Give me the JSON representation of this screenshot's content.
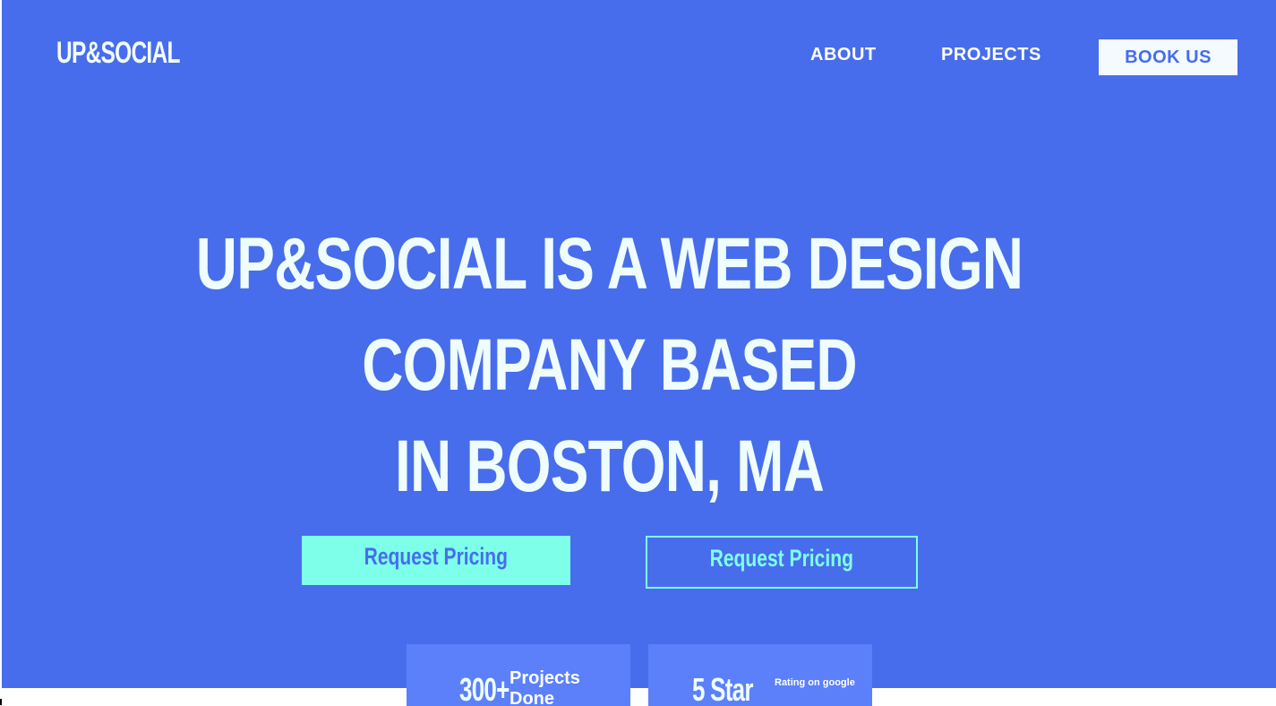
{
  "header": {
    "logo": "UP&SOCIAL",
    "nav": [
      {
        "label": "ABOUT"
      },
      {
        "label": "PROJECTS"
      }
    ],
    "book_label": "BOOK US"
  },
  "hero": {
    "headline_lines": [
      "UP&SOCIAL IS A WEB DESIGN",
      "COMPANY BASED",
      "IN BOSTON, MA"
    ],
    "primary_button": "Request Pricing",
    "secondary_button": "Request Pricing"
  },
  "stats": [
    {
      "value": "300+",
      "label": "Projects Done"
    },
    {
      "value": "5 Star",
      "label": "Rating on google"
    }
  ],
  "colors": {
    "background": "#476dec",
    "accent": "#7effea",
    "card": "#5b80fa",
    "text": "#f0fdff"
  }
}
